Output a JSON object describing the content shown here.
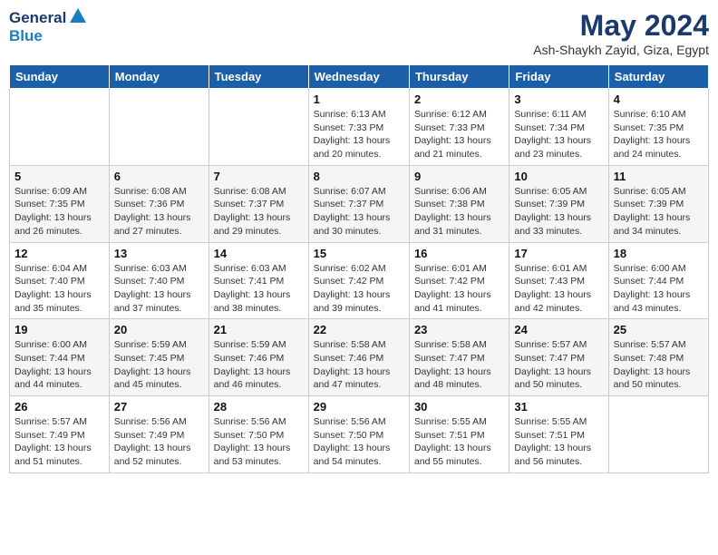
{
  "header": {
    "logo_general": "General",
    "logo_blue": "Blue",
    "main_title": "May 2024",
    "subtitle": "Ash-Shaykh Zayid, Giza, Egypt"
  },
  "days_of_week": [
    "Sunday",
    "Monday",
    "Tuesday",
    "Wednesday",
    "Thursday",
    "Friday",
    "Saturday"
  ],
  "weeks": [
    [
      {
        "day": "",
        "content": ""
      },
      {
        "day": "",
        "content": ""
      },
      {
        "day": "",
        "content": ""
      },
      {
        "day": "1",
        "content": "Sunrise: 6:13 AM\nSunset: 7:33 PM\nDaylight: 13 hours and 20 minutes."
      },
      {
        "day": "2",
        "content": "Sunrise: 6:12 AM\nSunset: 7:33 PM\nDaylight: 13 hours and 21 minutes."
      },
      {
        "day": "3",
        "content": "Sunrise: 6:11 AM\nSunset: 7:34 PM\nDaylight: 13 hours and 23 minutes."
      },
      {
        "day": "4",
        "content": "Sunrise: 6:10 AM\nSunset: 7:35 PM\nDaylight: 13 hours and 24 minutes."
      }
    ],
    [
      {
        "day": "5",
        "content": "Sunrise: 6:09 AM\nSunset: 7:35 PM\nDaylight: 13 hours and 26 minutes."
      },
      {
        "day": "6",
        "content": "Sunrise: 6:08 AM\nSunset: 7:36 PM\nDaylight: 13 hours and 27 minutes."
      },
      {
        "day": "7",
        "content": "Sunrise: 6:08 AM\nSunset: 7:37 PM\nDaylight: 13 hours and 29 minutes."
      },
      {
        "day": "8",
        "content": "Sunrise: 6:07 AM\nSunset: 7:37 PM\nDaylight: 13 hours and 30 minutes."
      },
      {
        "day": "9",
        "content": "Sunrise: 6:06 AM\nSunset: 7:38 PM\nDaylight: 13 hours and 31 minutes."
      },
      {
        "day": "10",
        "content": "Sunrise: 6:05 AM\nSunset: 7:39 PM\nDaylight: 13 hours and 33 minutes."
      },
      {
        "day": "11",
        "content": "Sunrise: 6:05 AM\nSunset: 7:39 PM\nDaylight: 13 hours and 34 minutes."
      }
    ],
    [
      {
        "day": "12",
        "content": "Sunrise: 6:04 AM\nSunset: 7:40 PM\nDaylight: 13 hours and 35 minutes."
      },
      {
        "day": "13",
        "content": "Sunrise: 6:03 AM\nSunset: 7:40 PM\nDaylight: 13 hours and 37 minutes."
      },
      {
        "day": "14",
        "content": "Sunrise: 6:03 AM\nSunset: 7:41 PM\nDaylight: 13 hours and 38 minutes."
      },
      {
        "day": "15",
        "content": "Sunrise: 6:02 AM\nSunset: 7:42 PM\nDaylight: 13 hours and 39 minutes."
      },
      {
        "day": "16",
        "content": "Sunrise: 6:01 AM\nSunset: 7:42 PM\nDaylight: 13 hours and 41 minutes."
      },
      {
        "day": "17",
        "content": "Sunrise: 6:01 AM\nSunset: 7:43 PM\nDaylight: 13 hours and 42 minutes."
      },
      {
        "day": "18",
        "content": "Sunrise: 6:00 AM\nSunset: 7:44 PM\nDaylight: 13 hours and 43 minutes."
      }
    ],
    [
      {
        "day": "19",
        "content": "Sunrise: 6:00 AM\nSunset: 7:44 PM\nDaylight: 13 hours and 44 minutes."
      },
      {
        "day": "20",
        "content": "Sunrise: 5:59 AM\nSunset: 7:45 PM\nDaylight: 13 hours and 45 minutes."
      },
      {
        "day": "21",
        "content": "Sunrise: 5:59 AM\nSunset: 7:46 PM\nDaylight: 13 hours and 46 minutes."
      },
      {
        "day": "22",
        "content": "Sunrise: 5:58 AM\nSunset: 7:46 PM\nDaylight: 13 hours and 47 minutes."
      },
      {
        "day": "23",
        "content": "Sunrise: 5:58 AM\nSunset: 7:47 PM\nDaylight: 13 hours and 48 minutes."
      },
      {
        "day": "24",
        "content": "Sunrise: 5:57 AM\nSunset: 7:47 PM\nDaylight: 13 hours and 50 minutes."
      },
      {
        "day": "25",
        "content": "Sunrise: 5:57 AM\nSunset: 7:48 PM\nDaylight: 13 hours and 50 minutes."
      }
    ],
    [
      {
        "day": "26",
        "content": "Sunrise: 5:57 AM\nSunset: 7:49 PM\nDaylight: 13 hours and 51 minutes."
      },
      {
        "day": "27",
        "content": "Sunrise: 5:56 AM\nSunset: 7:49 PM\nDaylight: 13 hours and 52 minutes."
      },
      {
        "day": "28",
        "content": "Sunrise: 5:56 AM\nSunset: 7:50 PM\nDaylight: 13 hours and 53 minutes."
      },
      {
        "day": "29",
        "content": "Sunrise: 5:56 AM\nSunset: 7:50 PM\nDaylight: 13 hours and 54 minutes."
      },
      {
        "day": "30",
        "content": "Sunrise: 5:55 AM\nSunset: 7:51 PM\nDaylight: 13 hours and 55 minutes."
      },
      {
        "day": "31",
        "content": "Sunrise: 5:55 AM\nSunset: 7:51 PM\nDaylight: 13 hours and 56 minutes."
      },
      {
        "day": "",
        "content": ""
      }
    ]
  ]
}
